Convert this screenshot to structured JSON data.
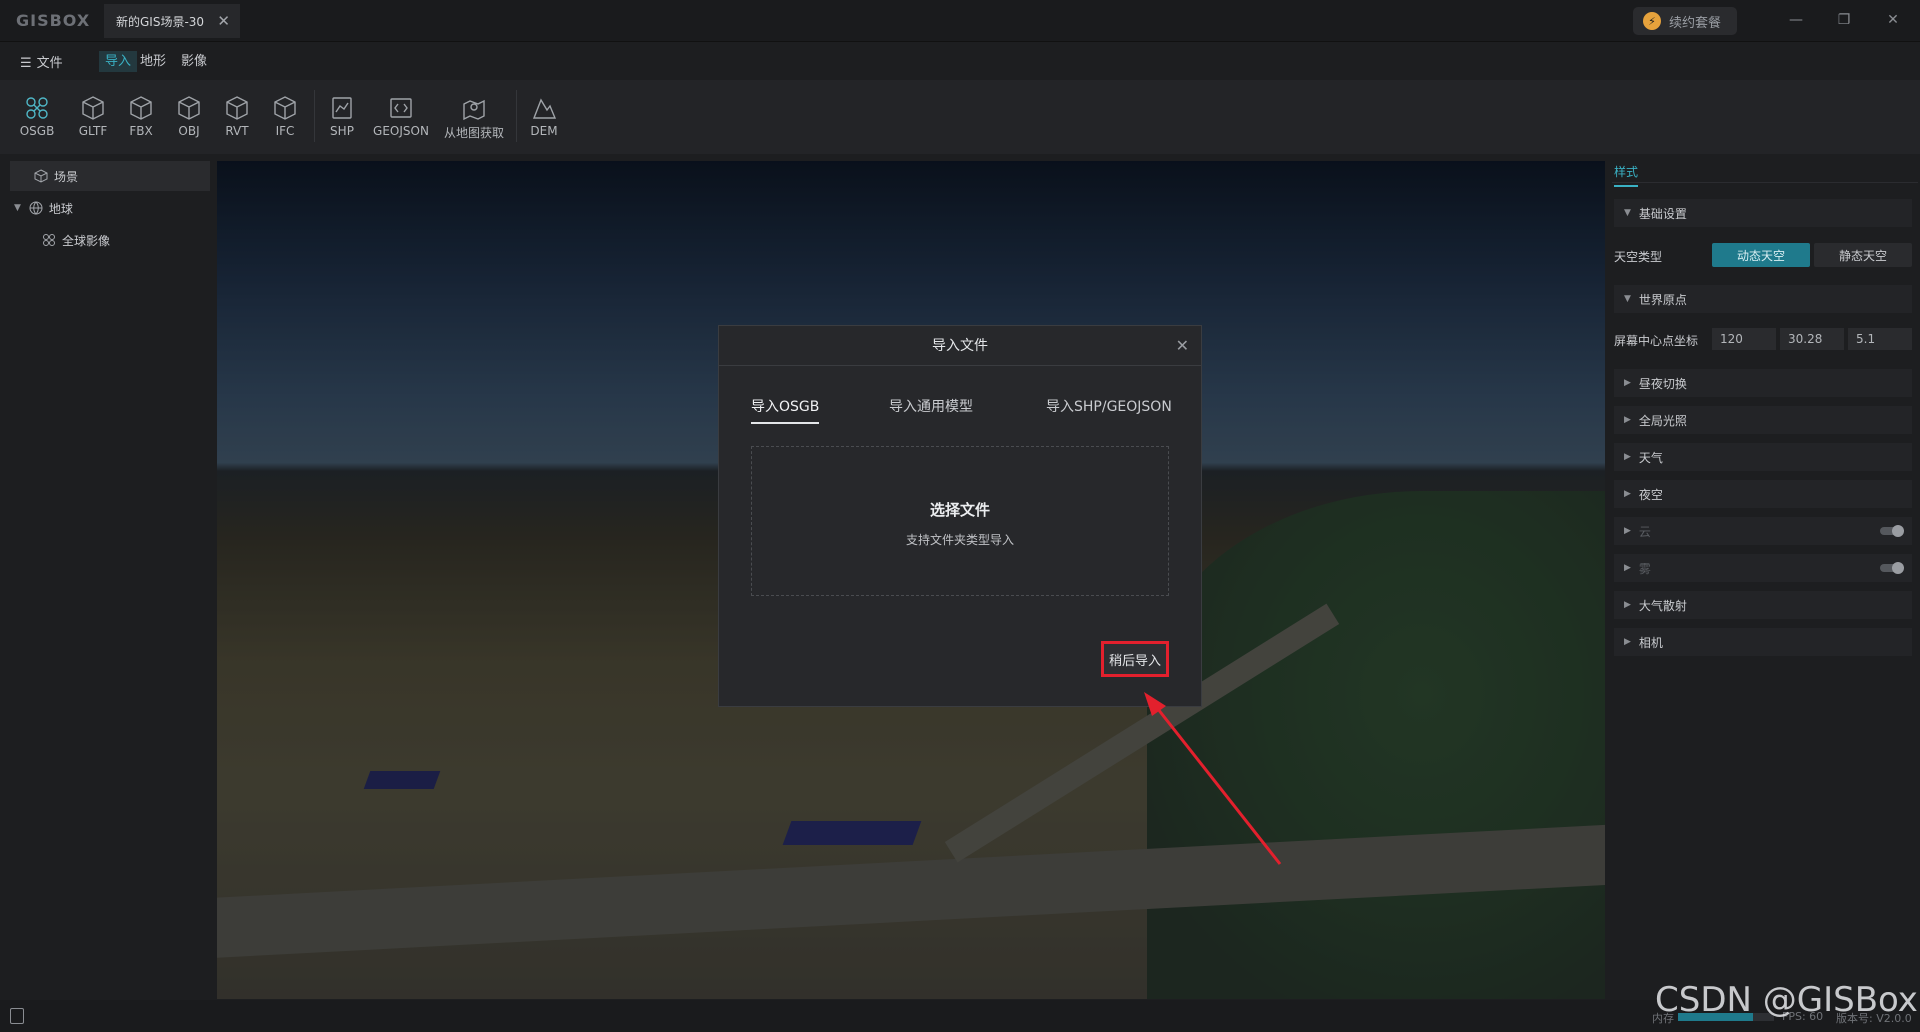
{
  "titlebar": {
    "logo": "GISBOX",
    "doc_tab": "新的GIS场景-30",
    "renew_label": "续约套餐"
  },
  "menubar": {
    "file_label": "文件",
    "tabs": [
      {
        "label": "导入",
        "active": true
      },
      {
        "label": "地形",
        "active": false
      },
      {
        "label": "影像",
        "active": false
      }
    ]
  },
  "toolbar": {
    "tools": [
      {
        "label": "OSGB",
        "icon": "drone-icon"
      },
      {
        "label": "GLTF",
        "icon": "cube-icon"
      },
      {
        "label": "FBX",
        "icon": "cube-icon"
      },
      {
        "label": "OBJ",
        "icon": "cube-icon"
      },
      {
        "label": "RVT",
        "icon": "cube-icon"
      },
      {
        "label": "IFC",
        "icon": "cube-icon"
      },
      {
        "label": "SHP",
        "icon": "shapefile-icon"
      },
      {
        "label": "GEOJSON",
        "icon": "geojson-icon"
      },
      {
        "label": "从地图获取",
        "icon": "map-pin-icon"
      },
      {
        "label": "DEM",
        "icon": "terrain-icon"
      }
    ]
  },
  "tree": {
    "scene": "场景",
    "earth": "地球",
    "global_imagery": "全球影像"
  },
  "rightpanel": {
    "tab": "样式",
    "basic": "基础设置",
    "sky_type_label": "天空类型",
    "sky_dynamic": "动态天空",
    "sky_static": "静态天空",
    "world_origin": "世界原点",
    "screen_center_label": "屏幕中心点坐标",
    "coords": [
      "120",
      "30.28",
      "5.1"
    ],
    "sections": [
      "昼夜切换",
      "全局光照",
      "天气",
      "夜空",
      "云",
      "雾",
      "大气散射",
      "相机"
    ]
  },
  "modal": {
    "title": "导入文件",
    "tabs": [
      "导入OSGB",
      "导入通用模型",
      "导入SHP/GEOJSON"
    ],
    "dropzone_title": "选择文件",
    "dropzone_sub": "支持文件夹类型导入",
    "later_button": "稍后导入"
  },
  "statusbar": {
    "memory_label": "内存",
    "memory_fraction": 0.78,
    "fps": "FPS: 60",
    "version": "版本号: V2.0.0"
  },
  "watermark": "CSDN @GISBox",
  "colors": {
    "accent": "#3ab1c4",
    "highlight": "#e3202d"
  }
}
